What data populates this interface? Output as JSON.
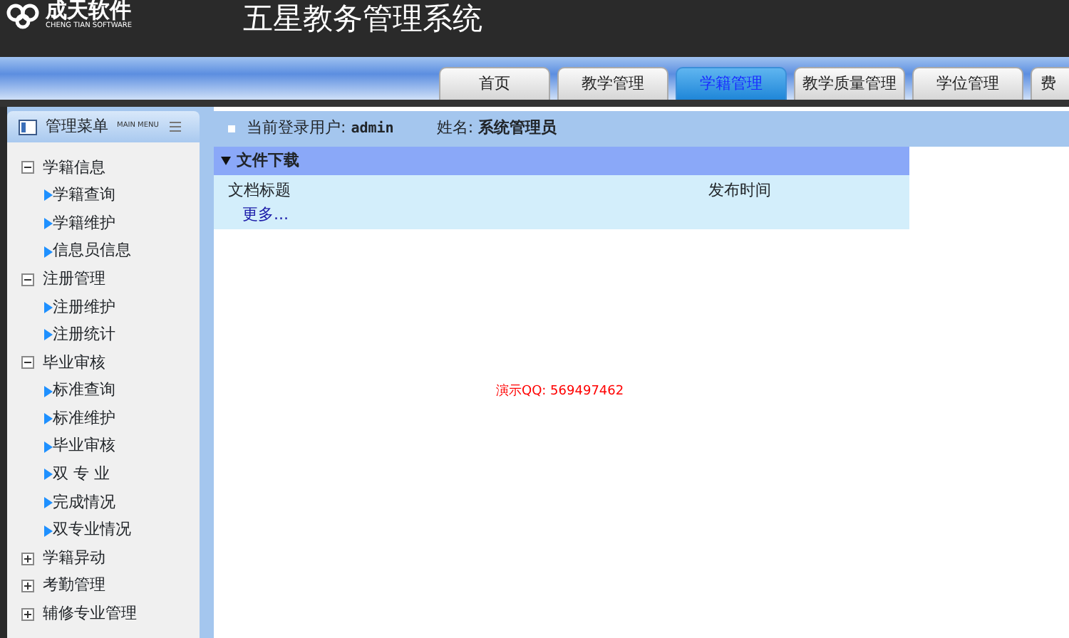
{
  "header": {
    "logo_name": "成天软件",
    "logo_subtitle": "CHENG TIAN SOFTWARE",
    "title": "五星教务管理系统"
  },
  "tabs": [
    {
      "label": "首页",
      "selected": false
    },
    {
      "label": "教学管理",
      "selected": false
    },
    {
      "label": "学籍管理",
      "selected": true
    },
    {
      "label": "教学质量管理",
      "selected": false
    },
    {
      "label": "学位管理",
      "selected": false
    },
    {
      "label": "费",
      "selected": false
    }
  ],
  "sidebar": {
    "title": "管理菜单",
    "subtitle": "MAIN MENU",
    "items": [
      {
        "label": "学籍信息",
        "expanded": true,
        "children": [
          {
            "label": "学籍查询"
          },
          {
            "label": "学籍维护"
          },
          {
            "label": "信息员信息"
          }
        ]
      },
      {
        "label": "注册管理",
        "expanded": true,
        "children": [
          {
            "label": "注册维护"
          },
          {
            "label": "注册统计"
          }
        ]
      },
      {
        "label": "毕业审核",
        "expanded": true,
        "children": [
          {
            "label": "标准查询"
          },
          {
            "label": "标准维护"
          },
          {
            "label": "毕业审核"
          },
          {
            "label": "双 专 业"
          },
          {
            "label": "完成情况"
          },
          {
            "label": "双专业情况"
          }
        ]
      },
      {
        "label": "学籍异动",
        "expanded": false
      },
      {
        "label": "考勤管理",
        "expanded": false
      },
      {
        "label": "辅修专业管理",
        "expanded": false
      }
    ]
  },
  "user_bar": {
    "user_label": "当前登录用户:",
    "user": "admin",
    "name_label": "姓名:",
    "name": "系统管理员"
  },
  "downloads": {
    "title": "文件下载",
    "columns": [
      "文档标题",
      "发布时间"
    ],
    "more": "更多..."
  },
  "demo_note": "演示QQ: 569497462"
}
